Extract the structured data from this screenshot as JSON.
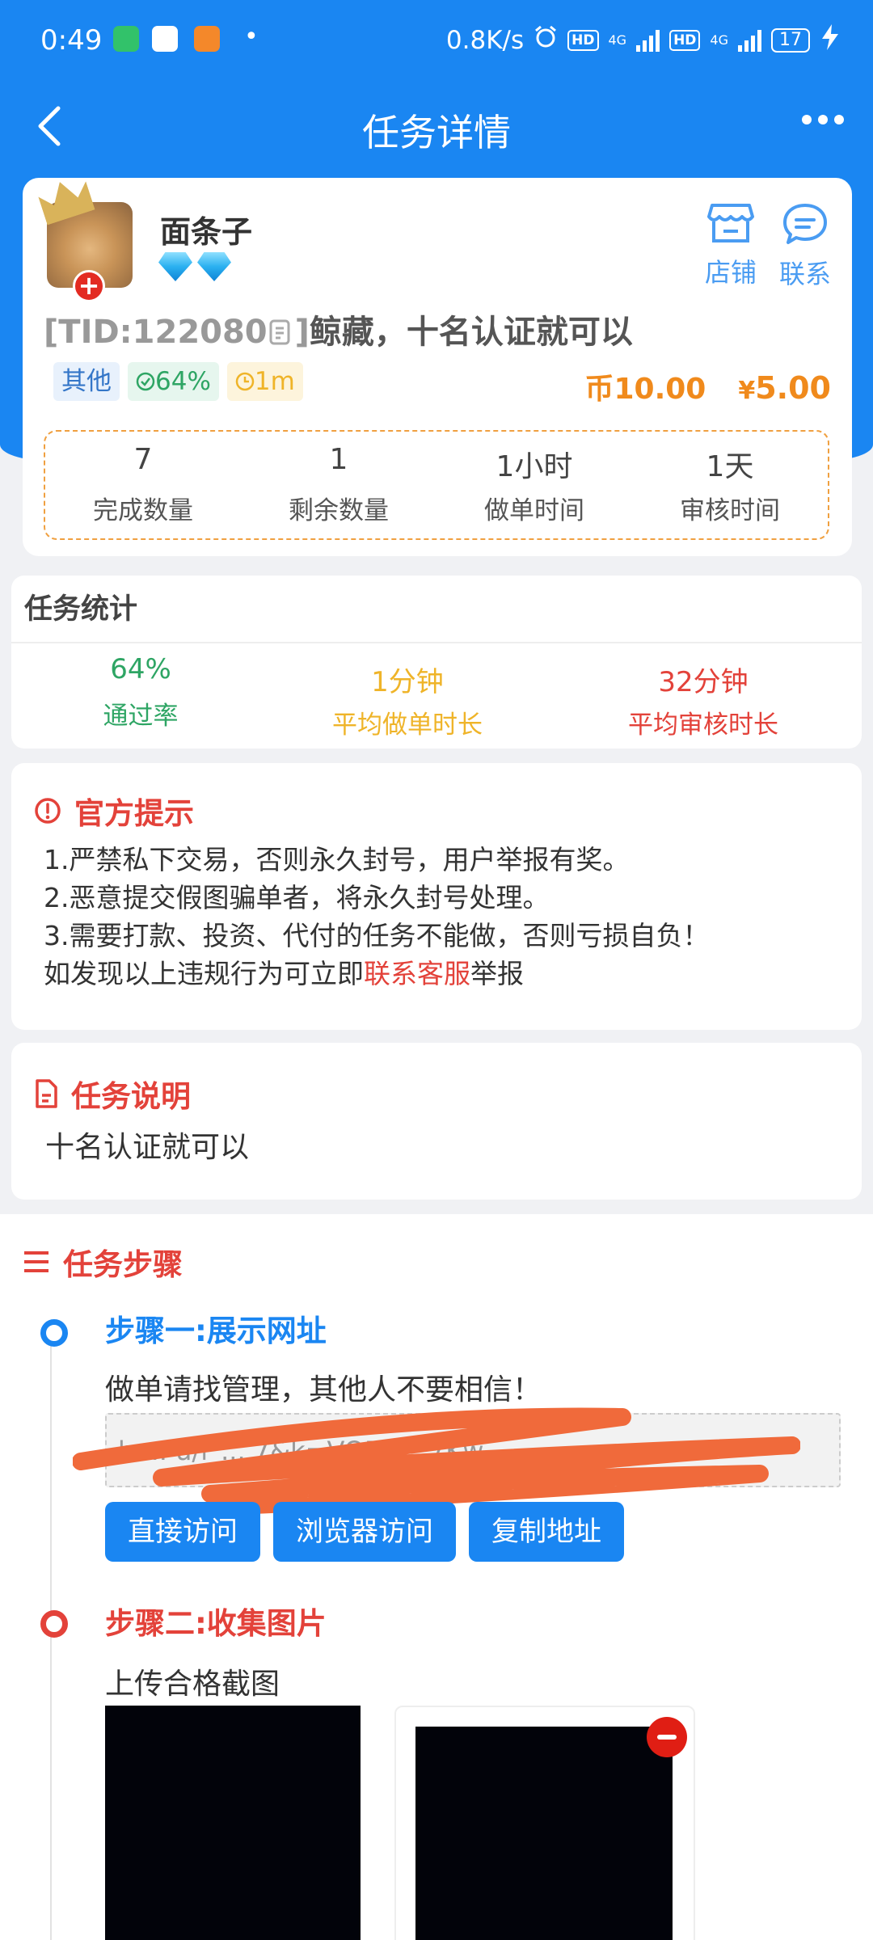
{
  "status_bar": {
    "time": "0:49",
    "net_speed": "0.8K/s",
    "hd1": "HD",
    "sig1": "4G",
    "hd2": "HD",
    "sig2": "4G",
    "battery": "17"
  },
  "nav": {
    "title": "任务详情"
  },
  "publisher": {
    "name": "面条子",
    "shop_label": "店铺",
    "contact_label": "联系"
  },
  "task": {
    "tid": "[TID:122080",
    "tid_close": "]",
    "title": "鲸藏，十名认证就可以",
    "tags": {
      "category": "其他",
      "pass_rate": "64%",
      "time": "1m"
    },
    "coin_symbol": "币",
    "coin_value": "10.00",
    "cny_symbol": "¥",
    "cny_value": "5.00"
  },
  "stats_box": [
    {
      "value": "7",
      "label": "完成数量"
    },
    {
      "value": "1",
      "label": "剩余数量"
    },
    {
      "value": "1小时",
      "label": "做单时间"
    },
    {
      "value": "1天",
      "label": "审核时间"
    }
  ],
  "task_stats": {
    "title": "任务统计",
    "items": [
      {
        "value": "64%",
        "label": "通过率",
        "color": "#2ea564"
      },
      {
        "value": "1分钟",
        "label": "平均做单时长",
        "color": "#efb429"
      },
      {
        "value": "32分钟",
        "label": "平均审核时长",
        "color": "#e3423a"
      }
    ]
  },
  "notice": {
    "title": "官方提示",
    "lines": [
      "1.严禁私下交易，否则永久封号，用户举报有奖。",
      "2.恶意提交假图骗单者，将永久封号处理。",
      "3.需要打款、投资、代付的任务不能做，否则亏损自负！"
    ],
    "last_prefix": "如发现以上违规行为可立即",
    "last_link": "联系客服",
    "last_suffix": "举报"
  },
  "description": {
    "title": "任务说明",
    "text": "十名认证就可以"
  },
  "steps": {
    "title": "任务步骤",
    "step1": {
      "title": "步骤一:展示网址",
      "text": "做单请找管理，其他人不要相信！",
      "url_fragment": "h ... u/l_... 7&k=VOEj ... 7Kw",
      "buttons": [
        "直接访问",
        "浏览器访问",
        "复制地址"
      ]
    },
    "step2": {
      "title": "步骤二:收集图片",
      "text": "上传合格截图"
    }
  },
  "colors": {
    "primary": "#1a86f2",
    "danger": "#e3423a",
    "orange": "#f08a1c"
  }
}
